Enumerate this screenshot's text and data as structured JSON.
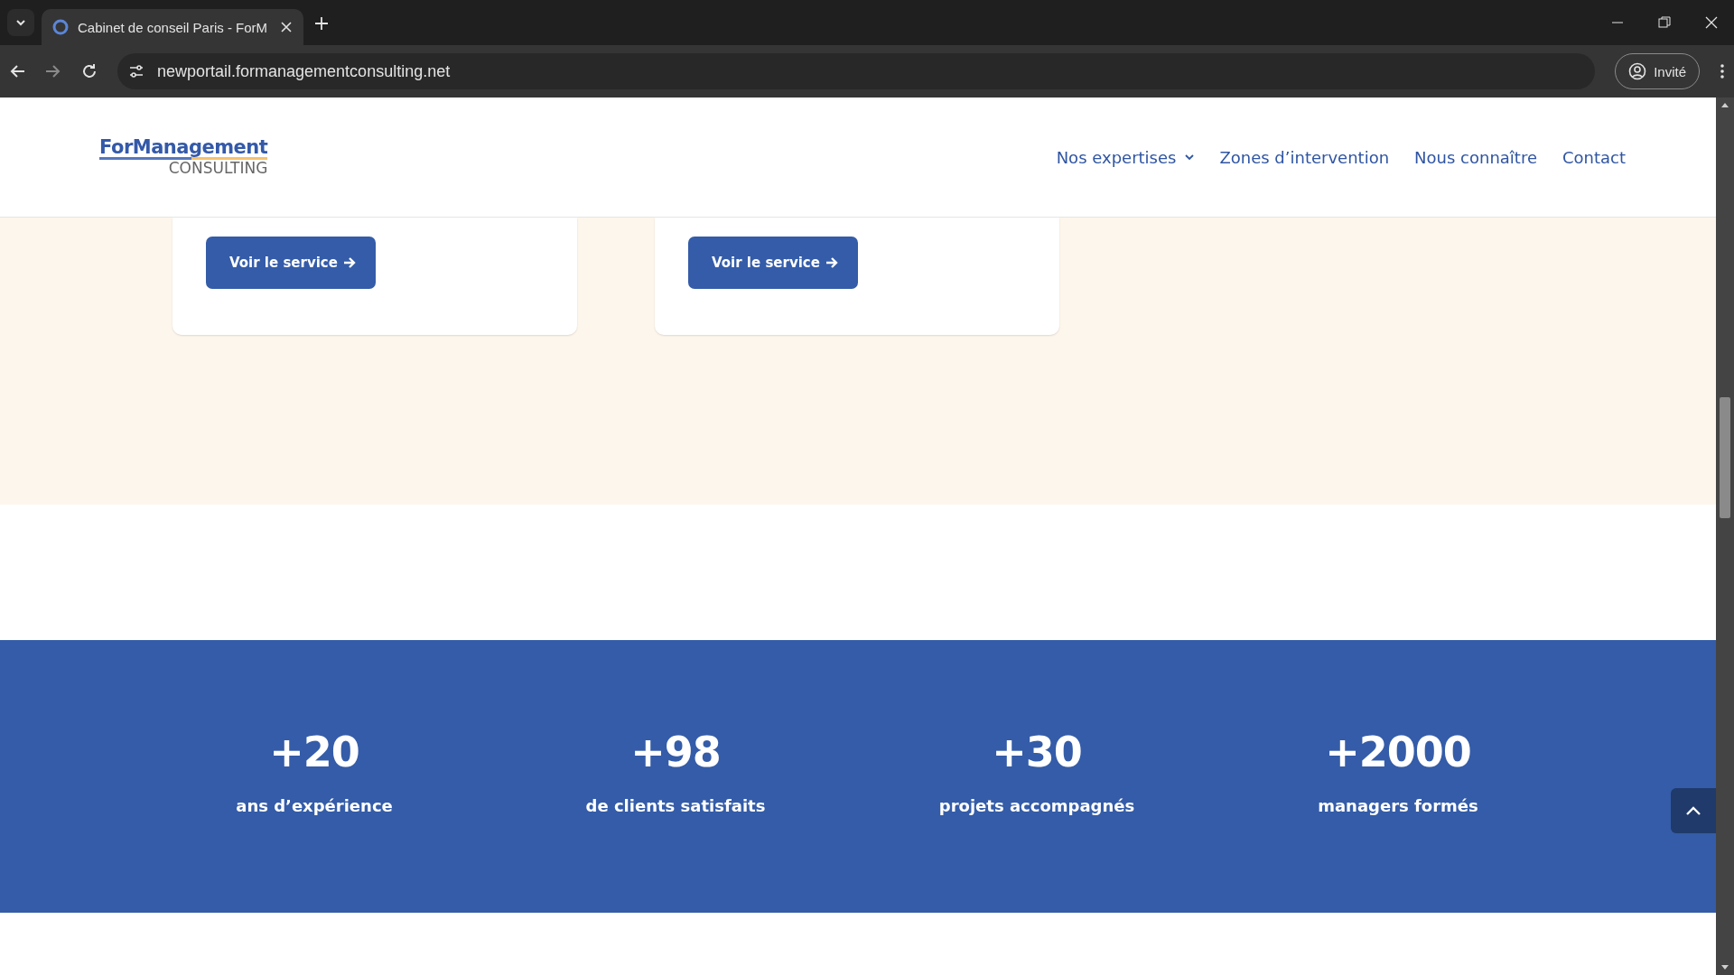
{
  "browser": {
    "tab_title": "Cabinet de conseil Paris - ForM",
    "url": "newportail.formanagementconsulting.net",
    "profile": "Invité"
  },
  "header": {
    "logo": {
      "main": "ForManagement",
      "sub": "CONSULTING"
    },
    "nav": [
      {
        "label": "Nos expertises",
        "dropdown": true
      },
      {
        "label": "Zones d’intervention",
        "dropdown": false
      },
      {
        "label": "Nous connaître",
        "dropdown": false
      },
      {
        "label": "Contact",
        "dropdown": false
      }
    ]
  },
  "services": [
    {
      "button": "Voir le service"
    },
    {
      "button": "Voir le service"
    }
  ],
  "stats": [
    {
      "value": "+20",
      "label": "ans d’expérience"
    },
    {
      "value": "+98",
      "label": "de clients satisfaits"
    },
    {
      "value": "+30",
      "label": "projets accompagnés"
    },
    {
      "value": "+2000",
      "label": "managers formés"
    }
  ]
}
